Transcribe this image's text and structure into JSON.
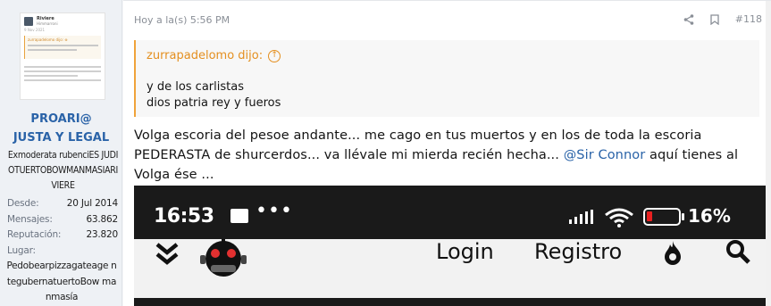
{
  "user": {
    "name_line1": "PROARI@",
    "name_line2": "JUSTA Y LEGAL",
    "title": "Exmoderata rubenciES JUDIOTUERTOBOWMANMASIARIVIERE",
    "stats": [
      {
        "label": "Desde:",
        "value": "20 Jul 2014"
      },
      {
        "label": "Mensajes:",
        "value": "63.862"
      },
      {
        "label": "Reputación:",
        "value": "23.820"
      },
      {
        "label": "Lugar:",
        "value": ""
      }
    ],
    "place": "Pedobearpizzagateage ntegubernatuertoBow manmasía",
    "avatar": {
      "name": "Riviere",
      "sub": "Himmarroni",
      "date": "9 Nov 2021",
      "quote_title": "zurrapadelomo dijo: ⊕"
    }
  },
  "post": {
    "time": "Hoy a la(s) 5:56 PM",
    "number": "#118",
    "quote": {
      "author": "zurrapadelomo dijo:",
      "lines": [
        "y de los carlistas",
        "dios patria rey y fueros"
      ]
    },
    "text_before_mention": "Volga escoria del pesoe andante... me cago en tus muertos y en los de toda la escoria PEDERASTA de shurcerdos... va llévale mi mierda recién hecha... ",
    "mention": "@Sir Connor",
    "text_after_mention": " aquí tienes al Volga ése ..."
  },
  "screenshot": {
    "time": "16:53",
    "battery": "16%",
    "battery_level": 0.16,
    "login": "Login",
    "register": "Registro",
    "battery_color": "#e82020"
  },
  "colors": {
    "accent": "#2a63a8",
    "quote": "#e48f1f"
  }
}
